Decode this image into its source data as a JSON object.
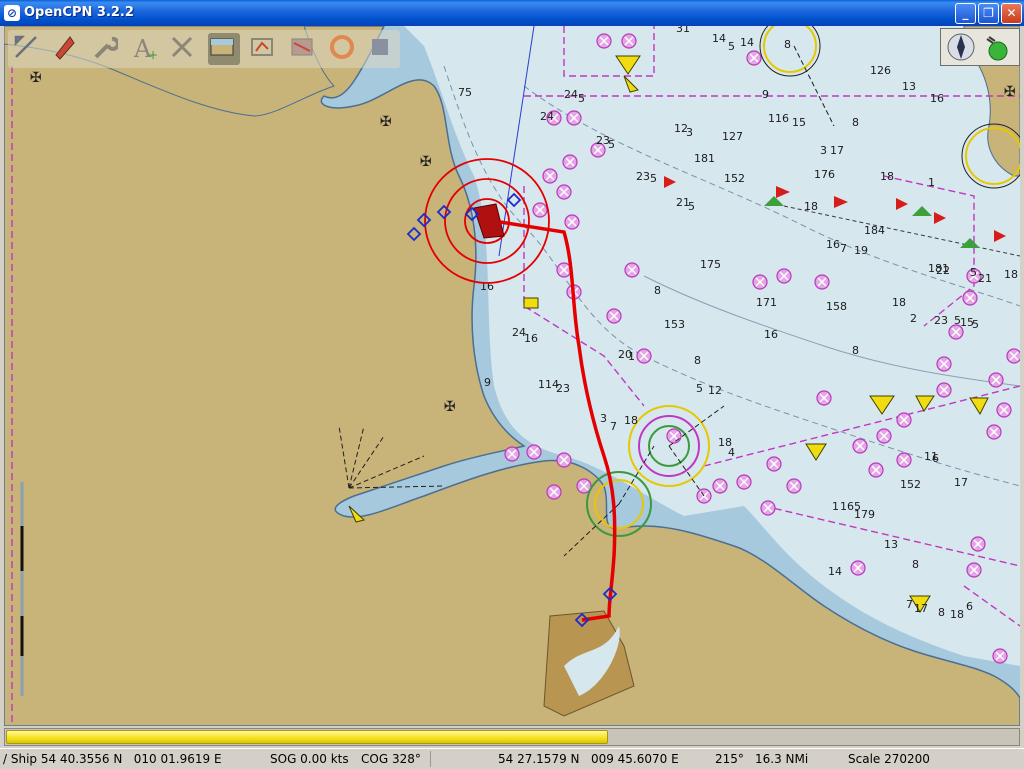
{
  "window": {
    "title": "OpenCPN 3.2.2",
    "icon": "opencpn-app-icon",
    "controls": [
      "minimize",
      "maximize",
      "close"
    ]
  },
  "toolbar": {
    "tools": [
      {
        "name": "zoom-tool-icon",
        "tooltip": ""
      },
      {
        "name": "ship-icon",
        "tooltip": ""
      },
      {
        "name": "wrench-settings-icon",
        "tooltip": ""
      },
      {
        "name": "text-a-icon",
        "tooltip": ""
      },
      {
        "name": "route-delete-x-icon",
        "tooltip": ""
      },
      {
        "name": "chart-layer-icon",
        "tooltip": "",
        "active": true
      },
      {
        "name": "waypoint-table-icon",
        "tooltip": ""
      },
      {
        "name": "tide-current-icon",
        "tooltip": ""
      },
      {
        "name": "lifebuoy-icon",
        "tooltip": ""
      },
      {
        "name": "help-icon",
        "tooltip": ""
      }
    ]
  },
  "map": {
    "colors": {
      "land": "#c8b379",
      "deep_water": "#d6e7ee",
      "shallow_water": "#a7c9dd",
      "depth_contour": "#4a6f93",
      "route": "#e40000",
      "restricted": "#c038c0",
      "waypoint": "#1d2bc8"
    },
    "depth_soundings": [
      "31",
      "14",
      "5",
      "14",
      "8",
      "126",
      "13",
      "16",
      "75",
      "24",
      "5",
      "24",
      "23",
      "5",
      "12",
      "3",
      "127",
      "9",
      "116",
      "15",
      "17",
      "3",
      "181",
      "176",
      "152",
      "8",
      "23",
      "5",
      "21",
      "5",
      "18",
      "175",
      "184",
      "16",
      "7",
      "19",
      "18",
      "1",
      "181",
      "22",
      "5",
      "21",
      "18",
      "8",
      "153",
      "171",
      "158",
      "16",
      "8",
      "18",
      "2",
      "23",
      "5",
      "15",
      "5",
      "24",
      "16",
      "8",
      "114",
      "23",
      "5",
      "12",
      "3",
      "18",
      "7",
      "20",
      "1",
      "16",
      "9",
      "18",
      "4",
      "11",
      "6",
      "152",
      "17",
      "1",
      "165",
      "179",
      "13",
      "8",
      "14",
      "7",
      "17",
      "8",
      "18",
      "6"
    ]
  },
  "compass": {
    "north_icon": "north-arrow-icon",
    "gps_status": "gps-ok-icon"
  },
  "progress": {
    "fraction": 0.595
  },
  "status": {
    "ship_position": "/ Ship 54 40.3556 N   010 01.9619 E",
    "sog": "SOG 0.00 kts",
    "cog": "COG 328°",
    "cursor_position": "54 27.1579 N   009 45.6070 E",
    "bearing": "215°",
    "distance": "16.3 NMi",
    "scale": "Scale 270200"
  }
}
